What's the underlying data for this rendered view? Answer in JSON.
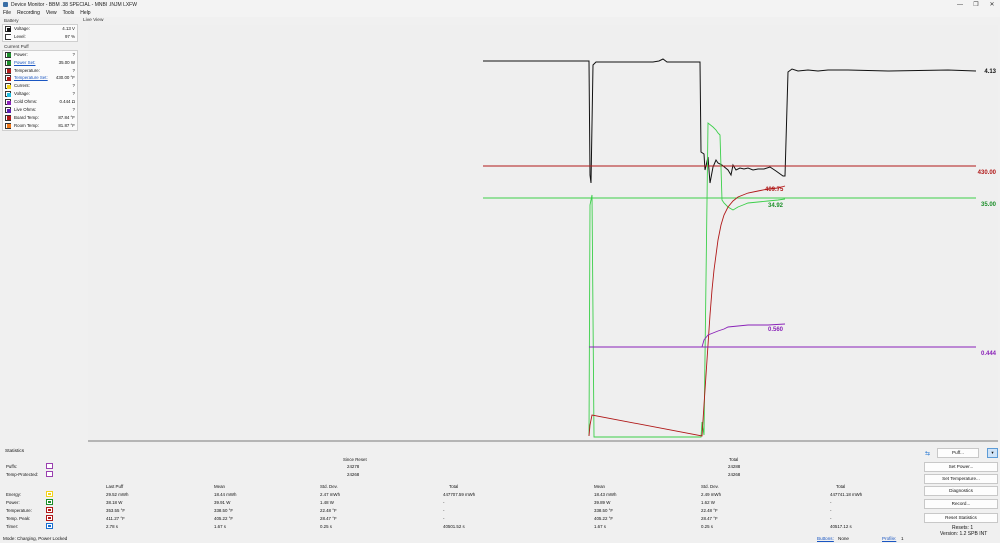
{
  "window": {
    "title": "Device Monitor - BBM .38 SPECIAL - MNBI .INJM LXFW",
    "minimize": "—",
    "maximize": "❐",
    "close": "✕"
  },
  "menu": [
    "File",
    "Recording",
    "View",
    "Tools",
    "Help"
  ],
  "battery": {
    "label": "Battery",
    "rows": [
      {
        "label": "Voltage:",
        "value": "4.13 V",
        "color": "#111111"
      },
      {
        "label": "Level:",
        "value": "97 %",
        "color": "#ffffff"
      }
    ]
  },
  "current_puff": {
    "label": "Current Puff",
    "rows": [
      {
        "label": "Power:",
        "value": "?",
        "color": "#1c8f2a",
        "link": false
      },
      {
        "label": "Power Set:",
        "value": "35.00 W",
        "color": "#1c8f2a",
        "link": true
      },
      {
        "label": "Temperature:",
        "value": "?",
        "color": "#b01818",
        "link": false
      },
      {
        "label": "Temperature Set:",
        "value": "430.00 °F",
        "color": "#b01818",
        "link": true
      },
      {
        "label": "Current:",
        "value": "?",
        "color": "#f2d21a",
        "link": false
      },
      {
        "label": "Voltage:",
        "value": "?",
        "color": "#1fbde0",
        "link": false
      },
      {
        "label": "Cold Ohms:",
        "value": "0.444 Ω",
        "color": "#8a22b8",
        "link": false
      },
      {
        "label": "Live Ohms:",
        "value": "?",
        "color": "#5a1fb0",
        "link": false
      },
      {
        "label": "Board Temp:",
        "value": "87.84 °F",
        "color": "#b01818",
        "link": false
      },
      {
        "label": "Room Temp:",
        "value": "81.87 °F",
        "color": "#f07a1a",
        "link": false
      }
    ]
  },
  "live_view": {
    "label": "Live View",
    "right_labels": {
      "voltage": "4.13",
      "temp_set": "430.00",
      "power_set": "35.00",
      "ohms": "0.444"
    },
    "inline_labels": {
      "temp": "409.75",
      "power": "34.92",
      "live_ohms": "0.560"
    },
    "colors": {
      "voltage": "#111111",
      "temp": "#b01818",
      "power": "#1c8f2a",
      "power_live": "#3ccf4a",
      "ohms": "#8a22b8"
    }
  },
  "statistics": {
    "label": "Statistics",
    "since_reset": "Since Reset",
    "total": "Total",
    "puffs_label": "Puffs:",
    "puffs_since": "24278",
    "puffs_total": "24288",
    "tp_label": "Temp-Protected:",
    "tp_since": "24268",
    "tp_total": "24268",
    "col_headers": [
      "Last Puff",
      "Mean",
      "Std. Dev.",
      "Total",
      "Mean",
      "Std. Dev.",
      "Total"
    ],
    "rows": [
      {
        "label": "Energy:",
        "color": "#f2d21a",
        "vals": [
          "29.52 mWh",
          "18.44 mWh",
          "2.47 mWh",
          "447707.59 mWh",
          "18.43 mWh",
          "2.49 mWh",
          "447741.18 mWh"
        ]
      },
      {
        "label": "Power:",
        "color": "#1c8f2a",
        "vals": [
          "38.18 W",
          "39.91 W",
          "1.48 W",
          "-",
          "39.89 W",
          "1.62 W",
          "-"
        ]
      },
      {
        "label": "Temperature:",
        "color": "#b01818",
        "vals": [
          "353.55 °F",
          "338.50 °F",
          "22.48 °F",
          "-",
          "338.50 °F",
          "22.48 °F",
          "-"
        ]
      },
      {
        "label": "Temp. Peak:",
        "color": "#b01818",
        "vals": [
          "411.27 °F",
          "405.22 °F",
          "28.47 °F",
          "-",
          "405.22 °F",
          "28.47 °F",
          "-"
        ]
      },
      {
        "label": "Timer:",
        "color": "#1a6fd0",
        "vals": [
          "2.78 s",
          "1.67 s",
          "0.25 s",
          "40501.52 s",
          "1.67 s",
          "0.25 s",
          "40517.12 s"
        ]
      }
    ]
  },
  "buttons": {
    "puff": "Puff...",
    "set_power": "Set Power...",
    "set_temperature": "Set Temperature...",
    "diagnostics": "Diagnostics",
    "record": "Record...",
    "reset_statistics": "Reset Statistics"
  },
  "resets": "Resets: 1",
  "version": "Version: 1.2 SPB INT",
  "status": {
    "mode": "Mode: Charging, Power Locked",
    "buttons_label": "Buttons:",
    "buttons_value": "None",
    "profile_label": "Profile:",
    "profile_value": "1"
  }
}
